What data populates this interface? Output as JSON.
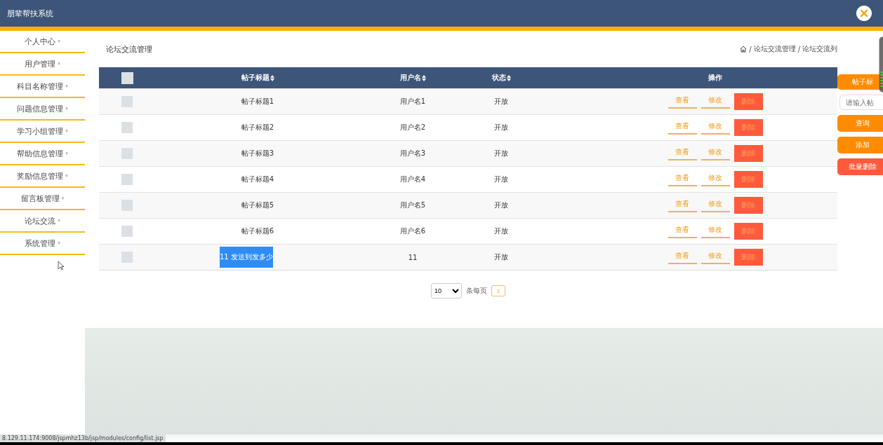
{
  "header": {
    "title": "朋辈帮扶系统"
  },
  "sidebar": {
    "items": [
      {
        "label": "个人中心",
        "caret": "▾"
      },
      {
        "label": "用户管理",
        "caret": "▾"
      },
      {
        "label": "科目名称管理",
        "caret": "▾"
      },
      {
        "label": "问题信息管理",
        "caret": "▾"
      },
      {
        "label": "学习小组管理",
        "caret": "▾"
      },
      {
        "label": "帮助信息管理",
        "caret": "▾"
      },
      {
        "label": "奖励信息管理",
        "caret": "▾"
      },
      {
        "label": "留言板管理",
        "caret": "▾"
      },
      {
        "label": "论坛交流",
        "caret": "▾"
      },
      {
        "label": "系统管理",
        "caret": "▾"
      }
    ]
  },
  "page_title": "论坛交流管理",
  "breadcrumb": [
    {
      "separator": "/",
      "label": "论坛交流管理"
    },
    {
      "separator": "/",
      "label": "论坛交流列"
    }
  ],
  "table": {
    "select_all_checked": false,
    "columns": [
      "帖子标题",
      "用户名",
      "状态",
      "操作"
    ],
    "rows": [
      {
        "checked": false,
        "title": "帖子标题1",
        "user": "用户名1",
        "status": "开放",
        "highlighted": false,
        "actions": [
          "查看",
          "修改",
          "删除"
        ]
      },
      {
        "checked": false,
        "title": "帖子标题2",
        "user": "用户名2",
        "status": "开放",
        "highlighted": false,
        "actions": [
          "查看",
          "修改",
          "删除"
        ]
      },
      {
        "checked": false,
        "title": "帖子标题3",
        "user": "用户名3",
        "status": "开放",
        "highlighted": false,
        "actions": [
          "查看",
          "修改",
          "删除"
        ]
      },
      {
        "checked": false,
        "title": "帖子标题4",
        "user": "用户名4",
        "status": "开放",
        "highlighted": false,
        "actions": [
          "查看",
          "修改",
          "删除"
        ]
      },
      {
        "checked": false,
        "title": "帖子标题5",
        "user": "用户名5",
        "status": "开放",
        "highlighted": false,
        "actions": [
          "查看",
          "修改",
          "删除"
        ]
      },
      {
        "checked": false,
        "title": "帖子标题6",
        "user": "用户名6",
        "status": "开放",
        "highlighted": false,
        "actions": [
          "查看",
          "修改",
          "删除"
        ]
      },
      {
        "checked": false,
        "title": "11 发送到发多少",
        "user": "11",
        "status": "开放",
        "highlighted": true,
        "actions": [
          "查看",
          "修改",
          "删除"
        ]
      }
    ]
  },
  "pagination": {
    "page_size": "10",
    "label": "条每页",
    "pages": [
      {
        "label": "1",
        "selected": true
      }
    ]
  },
  "search_panel": {
    "label": "帖子标",
    "placeholder": "请输入帖",
    "buttons": [
      {
        "label": "查询",
        "kind": "primary"
      },
      {
        "label": "添加",
        "kind": "primary"
      },
      {
        "label": "批量删除",
        "kind": "danger"
      }
    ]
  },
  "status_bar": {
    "url": "8.129.11.174:9008/jspmhz13b/jsp/modules/config/list.jsp"
  }
}
